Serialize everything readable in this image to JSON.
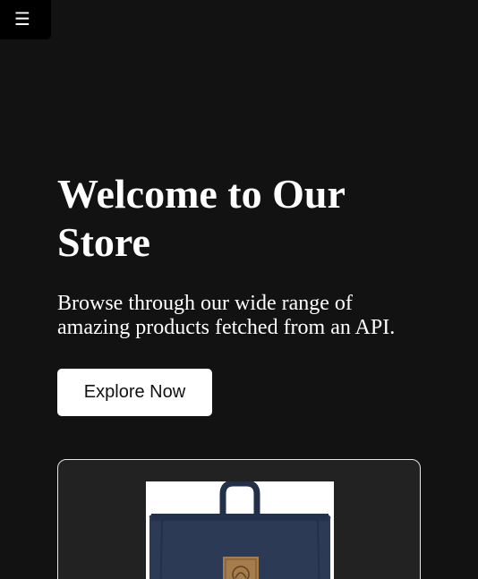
{
  "menu": {
    "icon": "hamburger-menu-icon",
    "glyph": "☰"
  },
  "hero": {
    "title": "Welcome to Our Store",
    "subtitle": "Browse through our wide range of amazing products fetched from an API.",
    "cta_label": "Explore Now"
  },
  "product": {
    "image": "navy-backpack-image"
  },
  "colors": {
    "background": "#121212",
    "card": "#222222",
    "button": "#ffffff",
    "bag": "#2c3a55",
    "patch": "#a57c4c"
  }
}
